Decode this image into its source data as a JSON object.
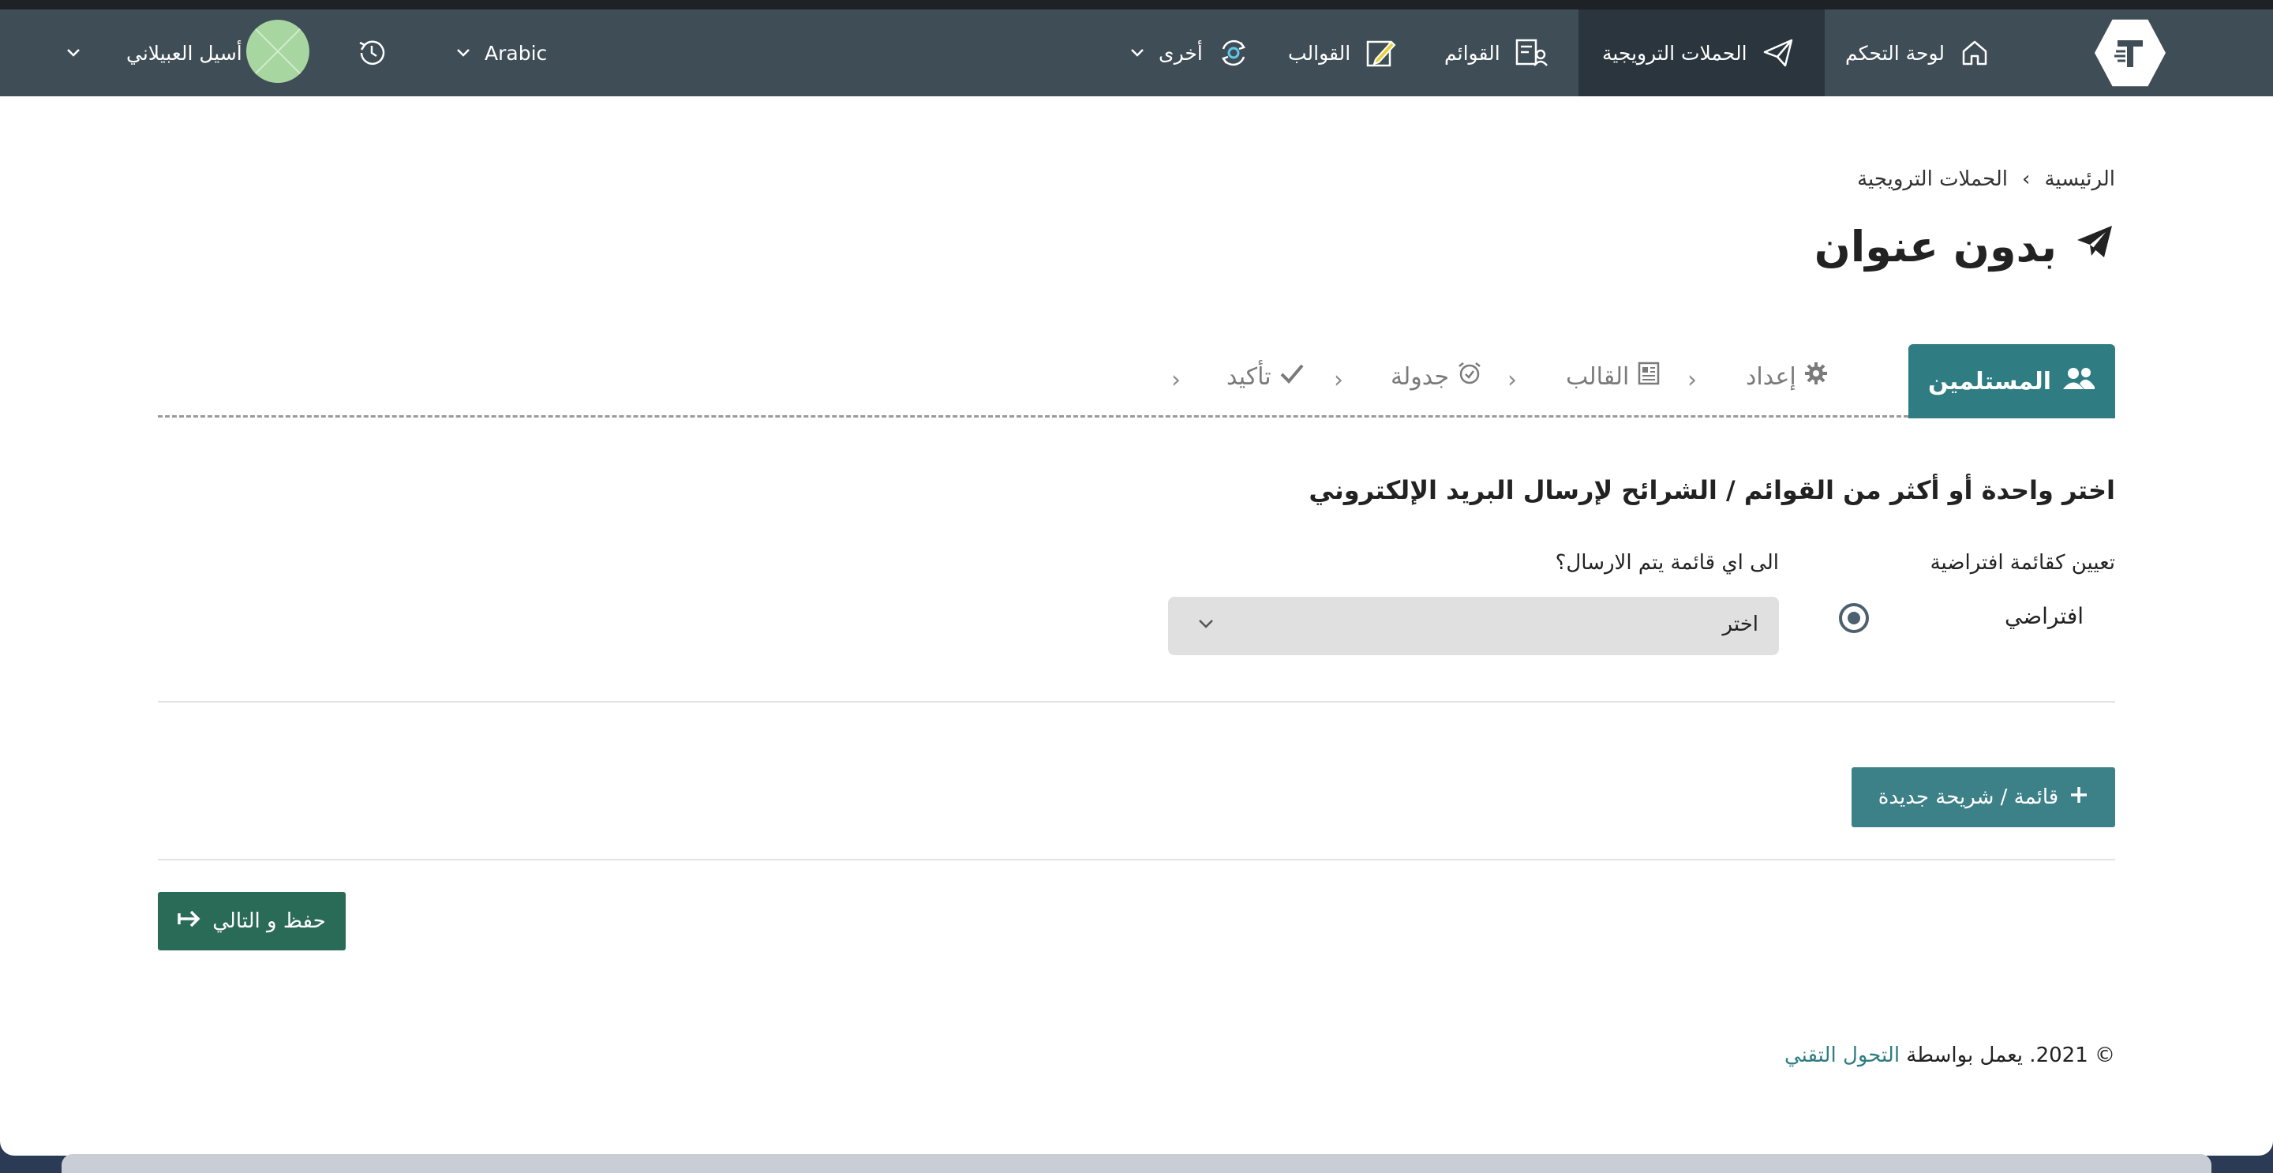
{
  "navbar": {
    "items": [
      {
        "label": "لوحة التحكم",
        "icon": "home-icon"
      },
      {
        "label": "الحملات الترويجية",
        "icon": "paper-plane-icon"
      },
      {
        "label": "القوائم",
        "icon": "contact-list-icon"
      },
      {
        "label": "القوالب",
        "icon": "edit-template-icon"
      },
      {
        "label": "أخرى",
        "icon": "refresh-gear-icon"
      }
    ],
    "language": "Arabic",
    "user_name": "أسيل العبيلاني",
    "history_icon": "history-icon"
  },
  "breadcrumb": {
    "home": "الرئيسية",
    "separator": "›",
    "current": "الحملات الترويجية"
  },
  "page_title": "بدون عنوان",
  "steps": [
    {
      "label": "المستلمين",
      "icon": "users-icon",
      "active": true
    },
    {
      "label": "إعداد",
      "icon": "gear-icon",
      "active": false
    },
    {
      "label": "القالب",
      "icon": "newspaper-icon",
      "active": false
    },
    {
      "label": "جدولة",
      "icon": "alarm-clock-icon",
      "active": false
    },
    {
      "label": "تأكيد",
      "icon": "check-icon",
      "active": false
    }
  ],
  "step_separator": "›",
  "form": {
    "heading": "اختر واحدة أو أكثر من القوائم / الشرائح لإرسال البريد الإلكتروني",
    "default_label": "تعيين كقائمة افتراضية",
    "which_list_label": "الى اي قائمة يتم الارسال؟",
    "radio_label": "افتراضي",
    "select_value": "اختر"
  },
  "buttons": {
    "new_list": "قائمة / شريحة جديدة",
    "save_next": "حفظ و التالي"
  },
  "footer": {
    "prefix": "© 2021. يعمل بواسطة ",
    "link": "التحول التقني"
  },
  "colors": {
    "navbar": "#3f4d57",
    "navbar_active": "#2a353d",
    "accent": "#2f7d82",
    "save": "#2a6b58"
  }
}
